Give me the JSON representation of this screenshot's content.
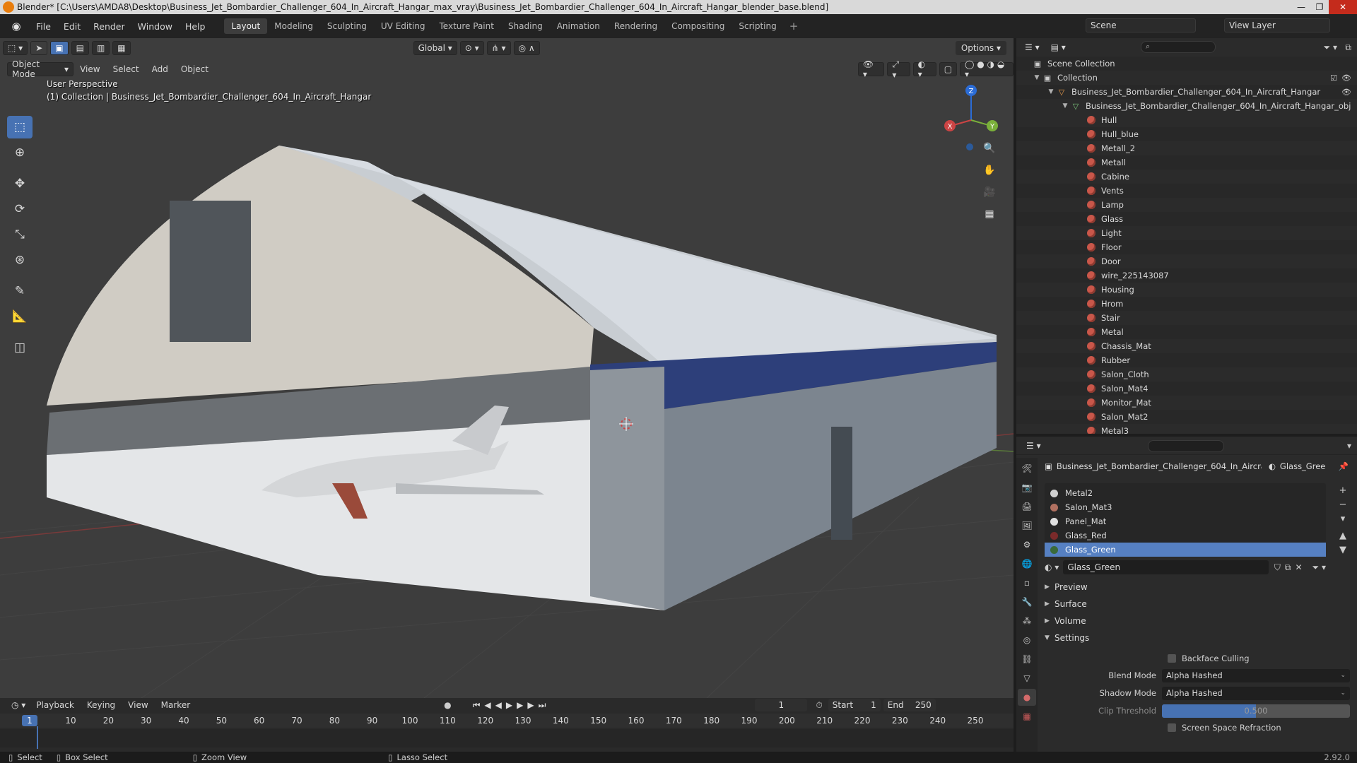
{
  "window": {
    "title": "Blender* [C:\\Users\\AMDA8\\Desktop\\Business_Jet_Bombardier_Challenger_604_In_Aircraft_Hangar_max_vray\\Business_Jet_Bombardier_Challenger_604_In_Aircraft_Hangar_blender_base.blend]",
    "minimize": "—",
    "maximize": "❐",
    "close": "✕"
  },
  "menu": [
    "File",
    "Edit",
    "Render",
    "Window",
    "Help"
  ],
  "workspaces": [
    "Layout",
    "Modeling",
    "Sculpting",
    "UV Editing",
    "Texture Paint",
    "Shading",
    "Animation",
    "Rendering",
    "Compositing",
    "Scripting"
  ],
  "active_workspace": "Layout",
  "scene": "Scene",
  "view_layer": "View Layer",
  "viewport": {
    "mode": "Object Mode",
    "menus": [
      "View",
      "Select",
      "Add",
      "Object"
    ],
    "transform_orientation": "Global",
    "options": "Options",
    "perspective": "User Perspective",
    "collection_info": "(1) Collection | Business_Jet_Bombardier_Challenger_604_In_Aircraft_Hangar",
    "gizmo": {
      "x": "X",
      "y": "Y",
      "z": "Z"
    }
  },
  "outliner": {
    "search_placeholder": "",
    "scene_collection": "Scene Collection",
    "collection": "Collection",
    "object_parent": "Business_Jet_Bombardier_Challenger_604_In_Aircraft_Hangar",
    "object_mesh": "Business_Jet_Bombardier_Challenger_604_In_Aircraft_Hangar_obj",
    "materials": [
      "Hull",
      "Hull_blue",
      "Metall_2",
      "Metall",
      "Cabine",
      "Vents",
      "Lamp",
      "Glass",
      "Light",
      "Floor",
      "Door",
      "wire_225143087",
      "Housing",
      "Hrom",
      "Stair",
      "Metal",
      "Chassis_Mat",
      "Rubber",
      "Salon_Cloth",
      "Salon_Mat4",
      "Monitor_Mat",
      "Salon_Mat2",
      "Metal3"
    ]
  },
  "properties": {
    "context_object": "Business_Jet_Bombardier_Challenger_604_In_Aircraft...",
    "context_material": "Glass_Gree",
    "slots": [
      {
        "name": "Metal2",
        "color": "#d0d0d0"
      },
      {
        "name": "Salon_Mat3",
        "color": "#b07060"
      },
      {
        "name": "Panel_Mat",
        "color": "#e0e0e0"
      },
      {
        "name": "Glass_Red",
        "color": "#7a2a2a"
      },
      {
        "name": "Glass_Green",
        "color": "#3a6a3a"
      }
    ],
    "active_slot": "Glass_Green",
    "material_name": "Glass_Green",
    "panels": {
      "preview": "Preview",
      "surface": "Surface",
      "volume": "Volume",
      "settings": "Settings"
    },
    "backface_culling": "Backface Culling",
    "blend_mode_label": "Blend Mode",
    "blend_mode": "Alpha Hashed",
    "shadow_mode_label": "Shadow Mode",
    "shadow_mode": "Alpha Hashed",
    "clip_threshold_label": "Clip Threshold",
    "clip_threshold": "0.500",
    "clip_threshold_fraction": 0.5,
    "ssr": "Screen Space Refraction"
  },
  "timeline": {
    "menus": [
      "Playback",
      "Keying",
      "View",
      "Marker"
    ],
    "current_frame": "1",
    "start_label": "Start",
    "start": "1",
    "end_label": "End",
    "end": "250",
    "ticks": [
      "1",
      "10",
      "20",
      "30",
      "40",
      "50",
      "60",
      "70",
      "80",
      "90",
      "100",
      "110",
      "120",
      "130",
      "140",
      "150",
      "160",
      "170",
      "180",
      "190",
      "200",
      "210",
      "220",
      "230",
      "240",
      "250"
    ]
  },
  "status": {
    "select": "Select",
    "box_select": "Box Select",
    "zoom_view": "Zoom View",
    "lasso_select": "Lasso Select",
    "version": "2.92.0"
  },
  "colors": {
    "accent": "#4772b3",
    "material_icon": "#c9574a",
    "hangar_band": "#2d3f7a"
  }
}
